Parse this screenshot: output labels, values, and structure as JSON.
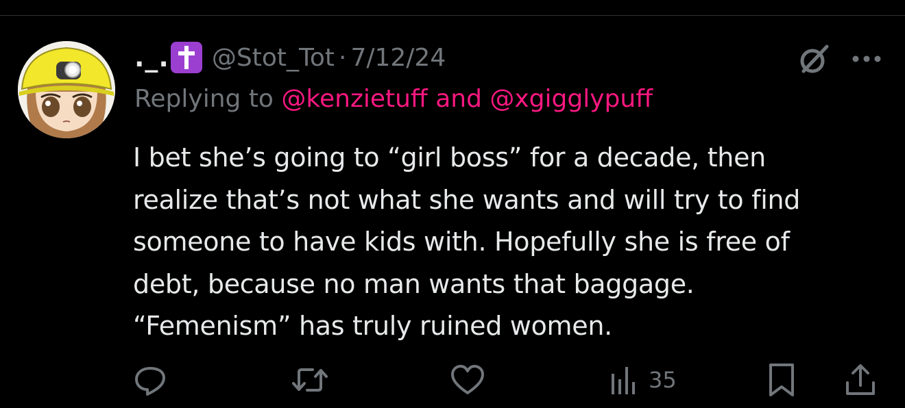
{
  "tweet": {
    "display_name": "._.",
    "badge_icon": "latin-cross-emoji",
    "handle": "@Stot_Tot",
    "separator": "·",
    "date": "7/12/24",
    "reply": {
      "prefix": "Replying to",
      "mention_1": "@kenzietuff",
      "joiner": "and",
      "mention_2": "@xgigglypuff"
    },
    "text_lines": [
      "I bet she’s going to “girl boss” for a decade, then",
      "realize that’s not what she wants and will try to find",
      "someone to have kids with. Hopefully she is free of",
      "debt, because no man wants that baggage.",
      "“Femenism” has truly ruined women."
    ],
    "actions": {
      "reply_icon": "reply-icon",
      "retweet_icon": "retweet-icon",
      "like_icon": "like-icon",
      "views_icon": "views-icon",
      "views_count": "35",
      "bookmark_icon": "bookmark-icon",
      "share_icon": "share-icon"
    }
  },
  "colors": {
    "background": "#000000",
    "text_primary": "#e7e9ea",
    "text_secondary": "#71767b",
    "mention": "#f91880",
    "badge": "#9b3fd1",
    "divider": "#2f3336"
  }
}
